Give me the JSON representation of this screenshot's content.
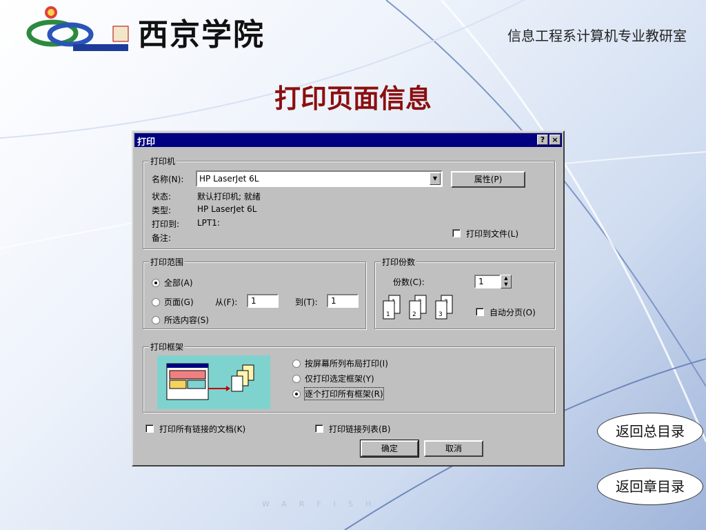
{
  "slide": {
    "school_name": "西京学院",
    "department": "信息工程系计算机专业教研室",
    "title": "打印页面信息",
    "watermark": "WARFISH",
    "nav": {
      "back_to_main": "返回总目录",
      "back_to_chapter": "返回章目录"
    }
  },
  "dialog": {
    "title": "打印",
    "help_button": "?",
    "close_button": "×",
    "printer_group": {
      "title": "打印机",
      "name_label": "名称(N):",
      "name_value": "HP LaserJet 6L",
      "properties_button": "属性(P)",
      "status_label": "状态:",
      "status_value": "默认打印机; 就绪",
      "type_label": "类型:",
      "type_value": "HP LaserJet 6L",
      "where_label": "打印到:",
      "where_value": "LPT1:",
      "comment_label": "备注:",
      "print_to_file": "打印到文件(L)"
    },
    "range_group": {
      "title": "打印范围",
      "all": "全部(A)",
      "pages": "页面(G)",
      "from_label": "从(F):",
      "from_value": "1",
      "to_label": "到(T):",
      "to_value": "1",
      "selection": "所选内容(S)"
    },
    "copies_group": {
      "title": "打印份数",
      "copies_label": "份数(C):",
      "copies_value": "1",
      "collate": "自动分页(O)"
    },
    "frames_group": {
      "title": "打印框架",
      "option_as_laid_out": "按屏幕所列布局打印(I)",
      "option_selected_frame": "仅打印选定框架(Y)",
      "option_all_frames": "逐个打印所有框架(R)"
    },
    "print_linked_docs": "打印所有链接的文档(K)",
    "print_link_table": "打印链接列表(B)",
    "ok_button": "确定",
    "cancel_button": "取消"
  }
}
